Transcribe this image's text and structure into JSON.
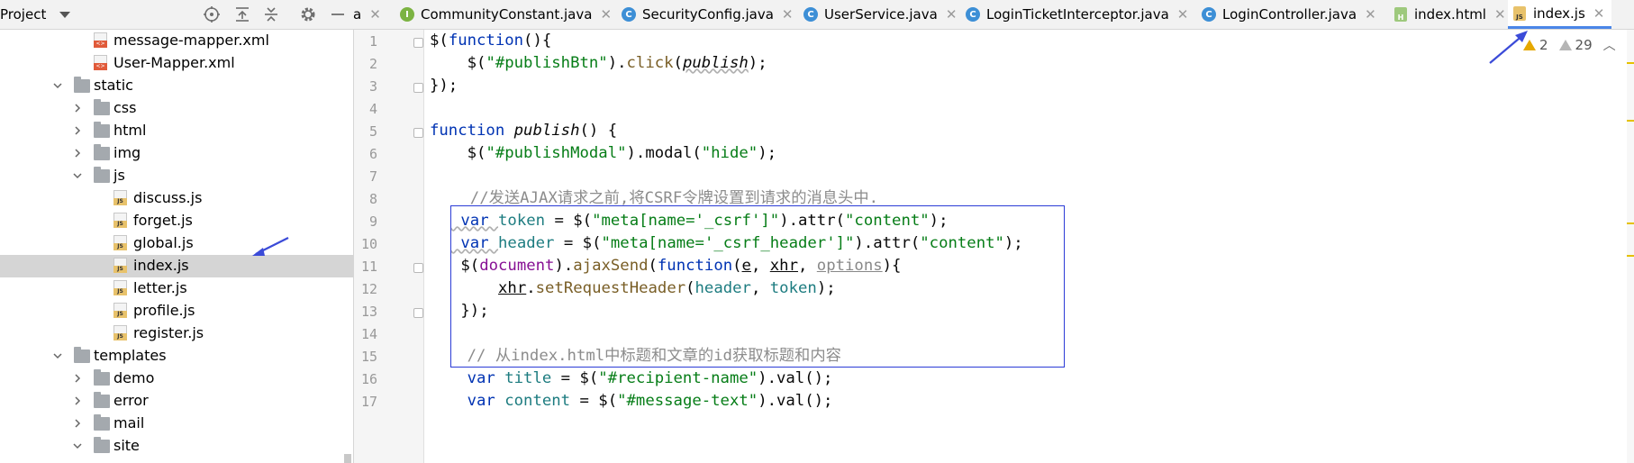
{
  "project": {
    "title": "Project"
  },
  "tabs": [
    {
      "label": "a",
      "icon": "truncated-tab",
      "color": "#000000"
    },
    {
      "label": "CommunityConstant.java",
      "icon": "interface-icon",
      "color": "#7cb342"
    },
    {
      "label": "SecurityConfig.java",
      "icon": "class-icon",
      "color": "#3d8fd6"
    },
    {
      "label": "UserService.java",
      "icon": "class-icon",
      "color": "#3d8fd6"
    },
    {
      "label": "LoginTicketInterceptor.java",
      "icon": "class-icon",
      "color": "#3d8fd6"
    },
    {
      "label": "LoginController.java",
      "icon": "class-icon",
      "color": "#3d8fd6"
    },
    {
      "label": "index.html",
      "icon": "html-file-icon",
      "color": "#9ec97d"
    },
    {
      "label": "index.js",
      "icon": "js-file-icon",
      "color": "#e8c26b"
    }
  ],
  "tree": [
    {
      "label": "message-mapper.xml",
      "type": "xml"
    },
    {
      "label": "User-Mapper.xml",
      "type": "xml"
    },
    {
      "label": "static",
      "type": "folder",
      "arrow": "down"
    },
    {
      "label": "css",
      "type": "folder",
      "arrow": "right"
    },
    {
      "label": "html",
      "type": "folder",
      "arrow": "right"
    },
    {
      "label": "img",
      "type": "folder",
      "arrow": "right"
    },
    {
      "label": "js",
      "type": "folder",
      "arrow": "down"
    },
    {
      "label": "discuss.js",
      "type": "js"
    },
    {
      "label": "forget.js",
      "type": "js"
    },
    {
      "label": "global.js",
      "type": "js"
    },
    {
      "label": "index.js",
      "type": "js",
      "selected": true
    },
    {
      "label": "letter.js",
      "type": "js"
    },
    {
      "label": "profile.js",
      "type": "js"
    },
    {
      "label": "register.js",
      "type": "js"
    },
    {
      "label": "templates",
      "type": "folder",
      "arrow": "down"
    },
    {
      "label": "demo",
      "type": "folder",
      "arrow": "right"
    },
    {
      "label": "error",
      "type": "folder",
      "arrow": "right"
    },
    {
      "label": "mail",
      "type": "folder",
      "arrow": "right"
    },
    {
      "label": "site",
      "type": "folder",
      "arrow": "down"
    }
  ],
  "line_numbers": [
    "1",
    "2",
    "3",
    "4",
    "5",
    "6",
    "7",
    "8",
    "9",
    "10",
    "11",
    "12",
    "13",
    "14",
    "15",
    "16",
    "17"
  ],
  "code": {
    "l1_a": "$(",
    "l1_b": "function",
    "l1_c": "(){",
    "l2_a": "    $(",
    "l2_b": "\"#publishBtn\"",
    "l2_c": ").",
    "l2_d": "click",
    "l2_e": "(",
    "l2_f": "publish",
    "l2_g": ");",
    "l3": "});",
    "l5_a": "function ",
    "l5_b": "publish",
    "l5_c": "() {",
    "l6_a": "    $(",
    "l6_b": "\"#publishModal\"",
    "l6_c": ").modal(",
    "l6_d": "\"hide\"",
    "l6_e": ");",
    "l8": "  //发送AJAX请求之前,将CSRF令牌设置到请求的消息头中.",
    "l9_a": " var ",
    "l9_b": "token",
    "l9_c": " = $(",
    "l9_d": "\"meta[name='_csrf']\"",
    "l9_e": ").attr(",
    "l9_f": "\"content\"",
    "l9_g": ");",
    "l10_a": " var ",
    "l10_b": "header",
    "l10_c": " = $(",
    "l10_d": "\"meta[name='_csrf_header']\"",
    "l10_e": ").attr(",
    "l10_f": "\"content\"",
    "l10_g": ");",
    "l11_a": " $(",
    "l11_b": "document",
    "l11_c": ").",
    "l11_d": "ajaxSend",
    "l11_e": "(",
    "l11_f": "function",
    "l11_g": "(",
    "l11_h": "e",
    "l11_i": ", ",
    "l11_j": "xhr",
    "l11_k": ", ",
    "l11_l": "options",
    "l11_m": "){",
    "l12_a": "     ",
    "l12_b": "xhr",
    "l12_c": ".",
    "l12_d": "setRequestHeader",
    "l12_e": "(",
    "l12_f": "header",
    "l12_g": ", ",
    "l12_h": "token",
    "l12_i": ");",
    "l13": " });",
    "l15": "    // 从index.html中标题和文章的id获取标题和内容",
    "l16_a": "    var ",
    "l16_b": "title",
    "l16_c": " = $(",
    "l16_d": "\"#recipient-name\"",
    "l16_e": ").val();",
    "l17_a": "    var ",
    "l17_b": "content",
    "l17_c": " = $(",
    "l17_d": "\"#message-text\"",
    "l17_e": ").val();"
  },
  "inspections": {
    "warnings": "2",
    "weak_warnings": "29"
  },
  "colors": {
    "accent": "#4a86e8",
    "highlight_box": "#2b3bd6",
    "annotation_arrow": "#3b4bd8"
  }
}
